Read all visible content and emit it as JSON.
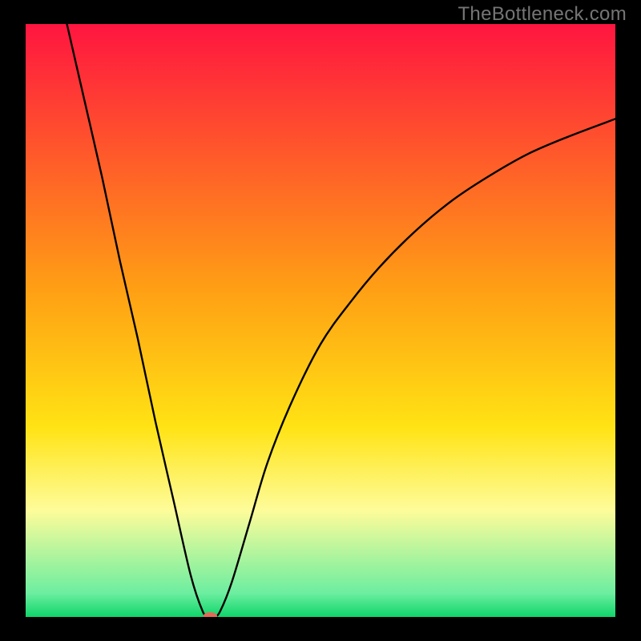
{
  "watermark": "TheBottleneck.com",
  "chart_data": {
    "type": "line",
    "title": "",
    "xlabel": "",
    "ylabel": "",
    "xlim": [
      0,
      100
    ],
    "ylim": [
      0,
      100
    ],
    "grid": false,
    "legend": false,
    "background_gradient": {
      "stops": [
        {
          "pos": 0,
          "color": "#ff1540"
        },
        {
          "pos": 45,
          "color": "#ffa014"
        },
        {
          "pos": 68,
          "color": "#ffe314"
        },
        {
          "pos": 82,
          "color": "#fefc9a"
        },
        {
          "pos": 96,
          "color": "#6ceea0"
        },
        {
          "pos": 100,
          "color": "#0fd56a"
        }
      ]
    },
    "series": [
      {
        "name": "bottleneck-curve",
        "x": [
          7,
          10,
          13,
          16,
          19,
          22,
          25,
          28,
          30,
          31,
          32,
          33,
          35,
          38,
          41,
          45,
          50,
          55,
          60,
          66,
          72,
          78,
          85,
          92,
          100
        ],
        "y": [
          100,
          87,
          74,
          60,
          47,
          33,
          20,
          7,
          1,
          0,
          0,
          1,
          6,
          16,
          26,
          36,
          46,
          53,
          59,
          65,
          70,
          74,
          78,
          81,
          84
        ]
      }
    ],
    "marker": {
      "x": 31.3,
      "y": 0.1,
      "color": "#e46a57",
      "rx": 1.2,
      "ry": 0.7
    }
  }
}
